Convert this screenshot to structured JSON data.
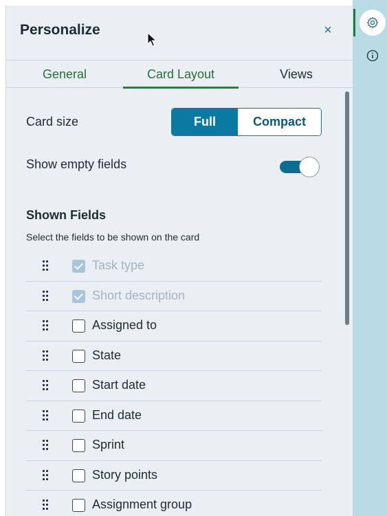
{
  "panel": {
    "title": "Personalize",
    "close_label": "×"
  },
  "tabs": [
    {
      "label": "General",
      "active": false
    },
    {
      "label": "Card Layout",
      "active": true
    },
    {
      "label": "Views",
      "active": false
    }
  ],
  "card_size": {
    "label": "Card size",
    "options": [
      "Full",
      "Compact"
    ],
    "selected": "Full"
  },
  "show_empty": {
    "label": "Show empty fields",
    "on": true
  },
  "shown_fields": {
    "title": "Shown Fields",
    "subtitle": "Select the fields to be shown on the card",
    "items": [
      {
        "label": "Task type",
        "checked": true,
        "disabled": true
      },
      {
        "label": "Short description",
        "checked": true,
        "disabled": true
      },
      {
        "label": "Assigned to",
        "checked": false,
        "disabled": false
      },
      {
        "label": "State",
        "checked": false,
        "disabled": false
      },
      {
        "label": "Start date",
        "checked": false,
        "disabled": false
      },
      {
        "label": "End date",
        "checked": false,
        "disabled": false
      },
      {
        "label": "Sprint",
        "checked": false,
        "disabled": false
      },
      {
        "label": "Story points",
        "checked": false,
        "disabled": false
      },
      {
        "label": "Assignment group",
        "checked": false,
        "disabled": false
      }
    ]
  },
  "rail": {
    "items": [
      {
        "icon": "gear-icon",
        "active": true
      },
      {
        "icon": "info-icon",
        "active": false
      }
    ]
  },
  "colors": {
    "accent": "#0b7aa3",
    "tab_active": "#2f7a3e",
    "panel_bg": "#e9eff3",
    "rail_bg": "#b9dce4"
  }
}
